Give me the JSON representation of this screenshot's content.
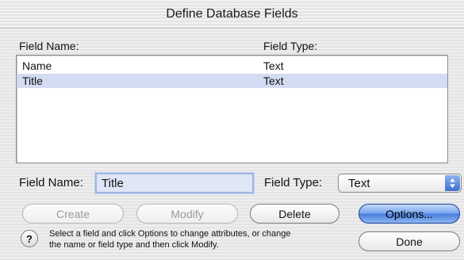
{
  "window": {
    "title": "Define Database Fields"
  },
  "list": {
    "header_name": "Field Name:",
    "header_type": "Field Type:",
    "rows": [
      {
        "name": "Name",
        "type": "Text",
        "selected": false
      },
      {
        "name": "Title",
        "type": "Text",
        "selected": true
      }
    ]
  },
  "editor": {
    "name_label": "Field Name:",
    "name_value": "Title",
    "type_label": "Field Type:",
    "type_value": "Text"
  },
  "buttons": {
    "create": "Create",
    "modify": "Modify",
    "delete": "Delete",
    "options": "Options...",
    "done": "Done"
  },
  "help": {
    "icon": "?",
    "text_line1": "Select a field and click Options to change attributes, or change",
    "text_line2": "the name or field type and then click Modify."
  },
  "colors": {
    "selection": "#d4dcf3",
    "default_button": "#4b7fdb"
  }
}
